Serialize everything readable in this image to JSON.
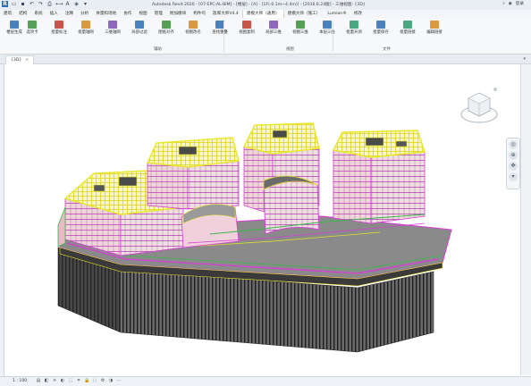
{
  "titlebar": {
    "title": "Autodesk Revit 2020 - [07-EPC-AL-BIM] - [楼层] - [A] - [1F(-0.1m~4.4m)] - [2016.6.24版] - 三维视图: {3D}",
    "user": "登录"
  },
  "tabs": [
    "建筑",
    "结构",
    "系统",
    "插入",
    "注释",
    "分析",
    "体量和场地",
    "协作",
    "视图",
    "管理",
    "附加模块",
    "构件坞",
    "族库大师V4.4",
    "建模大师（通用）",
    "建模大师（施工）",
    "Lumion®",
    "修改"
  ],
  "active_tab": "建模大师（通用）",
  "ribbon": {
    "buttons": [
      {
        "label": "楼层生成",
        "icon": "floor-generate-icon"
      },
      {
        "label": "选项卡",
        "icon": "option-card-icon"
      },
      {
        "label": "批量标注",
        "icon": "batch-dimension-icon"
      },
      {
        "label": "批量轴网",
        "icon": "batch-grid-icon"
      },
      {
        "label": "三维轴网",
        "icon": "3d-grid-icon"
      },
      {
        "label": "局部过滤",
        "icon": "local-filter-icon"
      },
      {
        "label": "图纸对齐",
        "icon": "sheet-align-icon"
      },
      {
        "label": "视图改名",
        "icon": "view-rename-icon"
      },
      {
        "label": "查找重叠",
        "icon": "find-overlap-icon"
      },
      {
        "label": "视图复制",
        "icon": "view-copy-icon"
      },
      {
        "label": "局部三维",
        "icon": "partial-3d-icon"
      },
      {
        "label": "视图三维",
        "icon": "view-3d-icon"
      },
      {
        "label": "本层三维",
        "icon": "floor-3d-icon"
      },
      {
        "label": "批量开洞",
        "icon": "batch-opening-icon"
      },
      {
        "label": "批量保存",
        "icon": "batch-save-icon"
      },
      {
        "label": "批量链接",
        "icon": "batch-link-icon"
      },
      {
        "label": "编辑链接",
        "icon": "edit-link-icon"
      }
    ],
    "groups": [
      "辅助",
      "视图",
      "文件"
    ]
  },
  "view_tab": {
    "label": "{3D}",
    "close": "×"
  },
  "statusbar": {
    "scale": "1 : 100"
  },
  "colors": {
    "magenta": "#d83bd8",
    "yellow": "#e8e82a",
    "green": "#38b84a",
    "dark": "#2c2c2c",
    "pink": "#f3d6dc"
  }
}
